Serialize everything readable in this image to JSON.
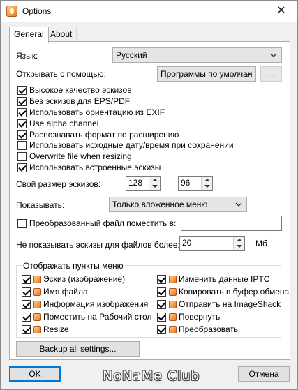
{
  "window": {
    "title": "Options",
    "close_glyph": "✕"
  },
  "tabs": [
    {
      "label": "General",
      "active": true
    },
    {
      "label": "About",
      "active": false
    }
  ],
  "general": {
    "language": {
      "label": "Язык:",
      "value": "Русский"
    },
    "open_with": {
      "label": "Открывать с помощью:",
      "value": "Программы по умолчан",
      "browse_label": "..."
    },
    "checkboxes": [
      {
        "label": "Высокое качество эскизов",
        "checked": true
      },
      {
        "label": "Без эскизов для EPS/PDF",
        "checked": true
      },
      {
        "label": "Использовать ориентацию из EXIF",
        "checked": true
      },
      {
        "label": "Use alpha channel",
        "checked": true
      },
      {
        "label": "Распознавать формат по расширению",
        "checked": true
      },
      {
        "label": "Использовать исходные дату/время при сохранении",
        "checked": false
      },
      {
        "label": "Overwrite file when resizing",
        "checked": false
      },
      {
        "label": "Использовать встроенные эскизы",
        "checked": true
      }
    ],
    "thumb_size": {
      "label": "Свой размер эскизов:",
      "width": "128",
      "height": "96"
    },
    "show": {
      "label": "Показывать:",
      "value": "Только вложенное меню"
    },
    "converted_file": {
      "label": "Преобразованный файл поместить в:",
      "checked": false,
      "value": ""
    },
    "skip_thumbs": {
      "label": "Не показывать эскизы для файлов более:",
      "value": "20",
      "unit": "Мб"
    },
    "menu_items": {
      "title": "Отображать пункты меню",
      "left": [
        {
          "label": "Эскиз (изображение)",
          "checked": true
        },
        {
          "label": "Имя файла",
          "checked": true
        },
        {
          "label": "Информация изображения",
          "checked": true
        },
        {
          "label": "Поместить на Рабочий стол",
          "checked": true
        },
        {
          "label": "Resize",
          "checked": true
        }
      ],
      "right": [
        {
          "label": "Изменить данные IPTC",
          "checked": true
        },
        {
          "label": "Копировать в буфер обмена",
          "checked": true
        },
        {
          "label": "Отправить на ImageShack",
          "checked": true
        },
        {
          "label": "Повернуть",
          "checked": true
        },
        {
          "label": "Преобразовать",
          "checked": true
        }
      ]
    },
    "backup_button": "Backup all settings..."
  },
  "footer": {
    "ok_label": "OK",
    "cancel_label": "Отмена",
    "watermark": "NoNaMe Club"
  }
}
